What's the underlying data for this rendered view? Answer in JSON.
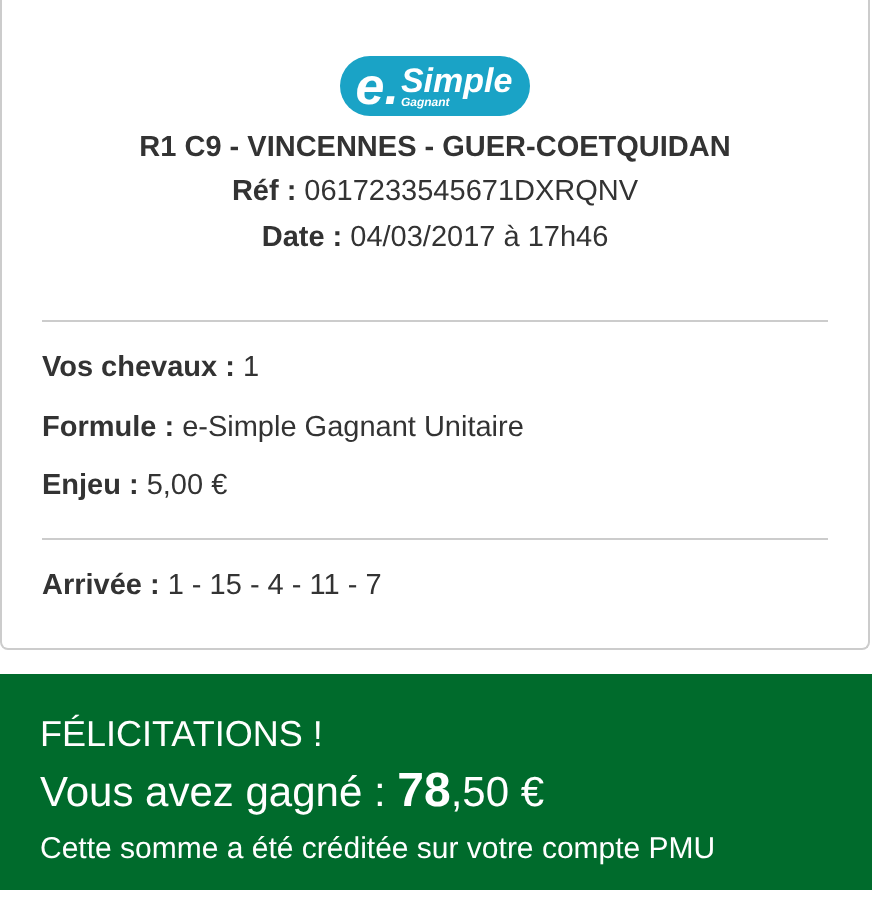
{
  "logo": {
    "prefix": "e.",
    "word": "Simple",
    "subtitle": "Gagnant"
  },
  "header": {
    "title": "R1 C9 - VINCENNES - GUER-COETQUIDAN",
    "lines": [
      {
        "label": "Réf :",
        "value": "0617233545671DXRQNV"
      },
      {
        "label": "Date :",
        "value": "04/03/2017 à 17h46"
      }
    ]
  },
  "bet": [
    {
      "label": "Vos chevaux :",
      "value": "1"
    },
    {
      "label": "Formule :",
      "value": "e-Simple Gagnant Unitaire"
    },
    {
      "label": "Enjeu :",
      "value": "5,00 €"
    }
  ],
  "result": [
    {
      "label": "Arrivée :",
      "value": "1 - 15 - 4 - 11 - 7"
    }
  ],
  "win": {
    "title": "FÉLICITATIONS !",
    "amount": "Vous avez gagné : **78**,50 €",
    "note": "Cette somme a été créditée sur votre compte PMU"
  }
}
